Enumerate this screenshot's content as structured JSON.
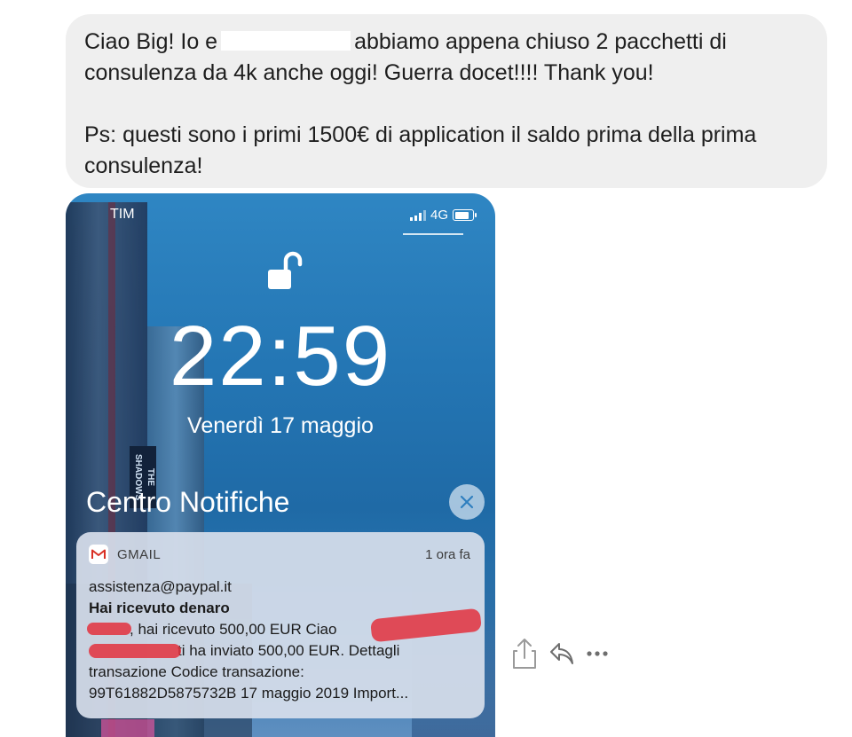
{
  "message": {
    "line1_before": "Ciao Big! Io e",
    "line1_after": "abbiamo appena chiuso 2 pacchetti di consulenza da 4k anche oggi! Guerra docet!!!! Thank you!",
    "ps": "Ps: questi sono i primi 1500€ di application il saldo prima della prima consulenza!"
  },
  "lockscreen": {
    "carrier": "TIM",
    "network": "4G",
    "time": "22:59",
    "date": "Venerdì 17 maggio",
    "notification_center_title": "Centro Notifiche",
    "building_sign": "THE SHADOWS"
  },
  "notification": {
    "app": "GMAIL",
    "age": "1 ora fa",
    "from": "assistenza@paypal.it",
    "subject": "Hai ricevuto denaro",
    "body_line1": ", hai ricevuto 500,00 EUR Ciao",
    "body_line2": "ti ha inviato 500,00 EUR. Dettagli",
    "body_line3": "transazione Codice transazione:",
    "body_line4": "99T61882D5875732B 17 maggio 2019 Import..."
  },
  "colors": {
    "bubble": "#efefef",
    "wallpaper_blue": "#2476b4",
    "redaction_red": "#e3313d",
    "gmail_red": "#d93025"
  }
}
